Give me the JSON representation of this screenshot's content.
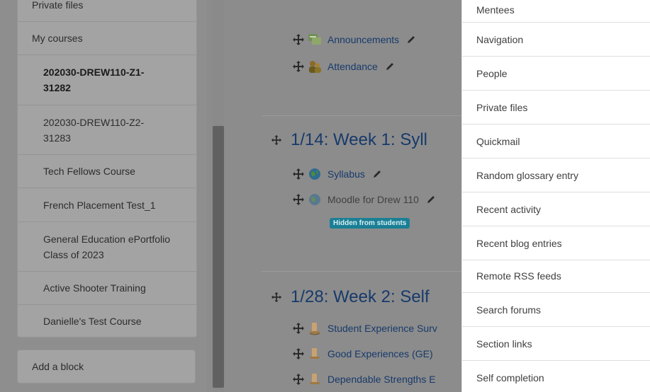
{
  "sidebar": {
    "top_partial": "Private files",
    "items": [
      {
        "label": "My courses"
      },
      {
        "label": "202030-DREW110-Z1-31282"
      },
      {
        "label": "202030-DREW110-Z2-31283"
      },
      {
        "label": "Tech Fellows Course"
      },
      {
        "label": "French Placement Test_1"
      },
      {
        "label": "General Education ePortfolio Class of 2023"
      },
      {
        "label": "Active Shooter Training"
      },
      {
        "label": "Danielle's Test Course"
      }
    ],
    "add_block": "Add a block"
  },
  "content": {
    "activities_top": [
      {
        "label": "Announcements",
        "icon": "forum-icon"
      },
      {
        "label": "Attendance",
        "icon": "attendance-icon"
      }
    ],
    "section1": {
      "title": "1/14: Week 1: Syll",
      "activities": [
        {
          "label": "Syllabus",
          "icon": "url-icon"
        },
        {
          "label": "Moodle for Drew 110",
          "icon": "url-icon"
        }
      ],
      "badge": "Hidden from students"
    },
    "section2": {
      "title": "1/28: Week 2: Self",
      "activities": [
        {
          "label": "Student Experience Surv",
          "icon": "assignment-icon"
        },
        {
          "label": "Good Experiences (GE)",
          "icon": "assignment-icon"
        },
        {
          "label": "Dependable Strengths E",
          "icon": "assignment-icon"
        }
      ]
    }
  },
  "add_block_panel": {
    "items": [
      {
        "label": "Mentees"
      },
      {
        "label": "Navigation"
      },
      {
        "label": "People"
      },
      {
        "label": "Private files"
      },
      {
        "label": "Quickmail"
      },
      {
        "label": "Random glossary entry"
      },
      {
        "label": "Recent activity"
      },
      {
        "label": "Recent blog entries"
      },
      {
        "label": "Remote RSS feeds"
      },
      {
        "label": "Search forums"
      },
      {
        "label": "Section links"
      },
      {
        "label": "Self completion"
      }
    ]
  }
}
